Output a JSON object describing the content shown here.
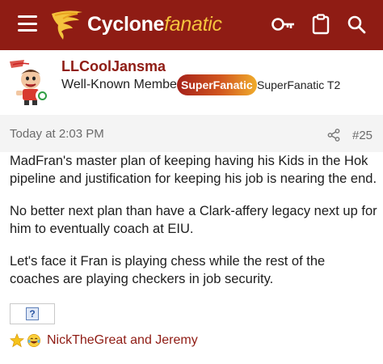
{
  "header": {
    "logo_main": "Cyclone",
    "logo_accent": "fanatic",
    "colors": {
      "bar": "#8f1c14",
      "accent": "#f4c33d"
    },
    "icons": [
      "menu-icon",
      "key-icon",
      "clipboard-icon",
      "search-icon"
    ]
  },
  "user": {
    "name": "LLCoolJansma",
    "role": "Well-Known Member",
    "badge": "SuperFanatic",
    "badge_tier": "SuperFanatic T2",
    "online": true
  },
  "post": {
    "timestamp": "Today at 2:03 PM",
    "number": "#25",
    "paragraphs": [
      "MadFran's master plan of keeping having his Kids in the Hok pipeline and justification for keeping his job is nearing the end.",
      "No better next plan than have a Clark-affery legacy next up for him to eventually coach at EIU.",
      "Let's face it Fran is playing chess while the rest of the coaches are playing checkers in job security."
    ],
    "image_placeholder": "?"
  },
  "reactions": {
    "icons": [
      "star-reaction-icon",
      "laughing-reaction-icon"
    ],
    "names": "NickTheGreat and Jeremy"
  }
}
